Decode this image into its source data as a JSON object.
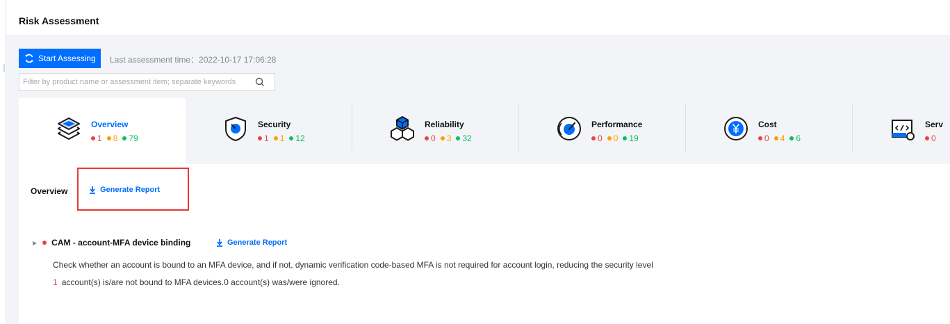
{
  "header": {
    "title": "Risk Assessment"
  },
  "toolbar": {
    "start_label": "Start Assessing",
    "last_time": "Last assessment time：2022-10-17 17:06:28"
  },
  "search": {
    "placeholder": "Filter by product name or assessment item; separate keywords",
    "value": ""
  },
  "tabs": [
    {
      "label": "Overview",
      "icon": "layers-icon",
      "high": "1",
      "medium": "8",
      "low": "79"
    },
    {
      "label": "Security",
      "icon": "shield-icon",
      "high": "1",
      "medium": "1",
      "low": "12"
    },
    {
      "label": "Reliability",
      "icon": "cubes-icon",
      "high": "0",
      "medium": "3",
      "low": "32"
    },
    {
      "label": "Performance",
      "icon": "gauge-icon",
      "high": "0",
      "medium": "0",
      "low": "19"
    },
    {
      "label": "Cost",
      "icon": "yen-icon",
      "high": "0",
      "medium": "4",
      "low": "6"
    },
    {
      "label": "Serv",
      "icon": "code-gear-icon",
      "high": "0"
    }
  ],
  "panel": {
    "title": "Overview",
    "generate_label": "Generate Report",
    "item": {
      "name": "CAM - account-MFA device binding",
      "generate_label": "Generate Report",
      "description": "Check whether an account is bound to an MFA device, and if not, dynamic verification code-based MFA is not required for account login, reducing the security level",
      "count": "1",
      "stats_text": "account(s) is/are not bound to MFA devices.0  account(s) was/were ignored."
    }
  },
  "colors": {
    "accent": "#006eff",
    "high": "#e54545",
    "medium": "#ff9d00",
    "low": "#0abf5b",
    "highlight": "#e53935"
  }
}
